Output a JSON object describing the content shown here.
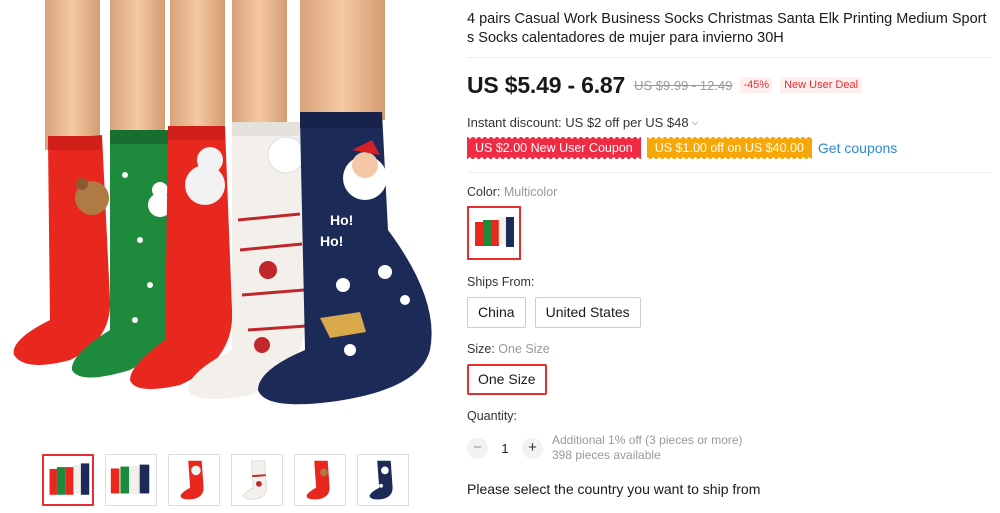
{
  "product": {
    "title": "4 pairs Casual Work Business Socks Christmas Santa Elk Printing Medium Sports Socks calentadores de mujer para invierno 30H",
    "price": "US $5.49 - 6.87",
    "original_price": "US $9.99 - 12.49",
    "discount": "-45%",
    "deal_badge": "New User Deal"
  },
  "instant_discount": {
    "text": "Instant discount: US $2 off per US $48",
    "chevron_icon": "chevron-down-icon"
  },
  "coupons": {
    "items": [
      {
        "label": "US $2.00 New User Coupon",
        "color": "#f02c44"
      },
      {
        "label": "US $1.00 off on US $40.00",
        "color": "#f7a707"
      }
    ],
    "get_label": "Get coupons"
  },
  "color": {
    "label": "Color:",
    "value": "Multicolor"
  },
  "ships_from": {
    "label": "Ships From:",
    "options": [
      "China",
      "United States"
    ]
  },
  "size": {
    "label": "Size:",
    "value": "One Size",
    "options": [
      "One Size"
    ]
  },
  "quantity": {
    "label": "Quantity:",
    "minus": "−",
    "plus": "+",
    "value": "1",
    "note_line1": "Additional 1% off (3 pieces or more)",
    "note_line2": "398 pieces available"
  },
  "shipping_message": "Please select the country you want to ship from",
  "gallery": {
    "thumb_count": 6,
    "active_index": 0
  },
  "colors": {
    "accent": "#e62e2e",
    "sock_red": "#e8271f",
    "sock_green": "#1e8a3c",
    "sock_white": "#f3f0ec",
    "sock_navy": "#1c2a57",
    "link": "#2b8ad8"
  }
}
